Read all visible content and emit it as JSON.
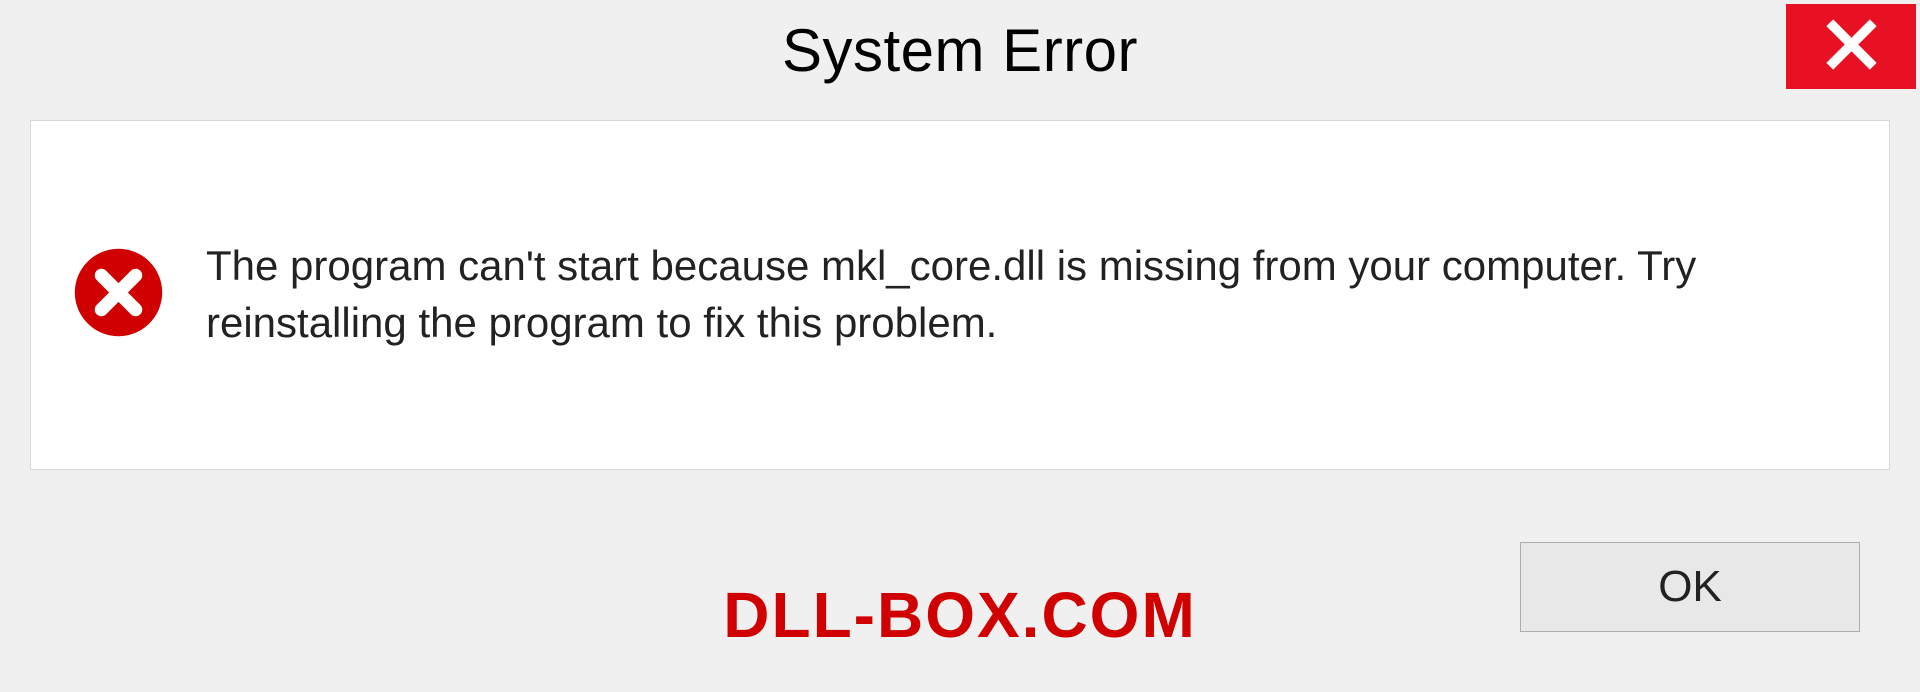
{
  "dialog": {
    "title": "System Error",
    "message": "The program can't start because mkl_core.dll is missing from your computer. Try reinstalling the program to fix this problem.",
    "ok_label": "OK"
  },
  "watermark": "DLL-BOX.COM",
  "colors": {
    "close_bg": "#e81123",
    "error_icon": "#d10000",
    "watermark": "#d10000"
  }
}
